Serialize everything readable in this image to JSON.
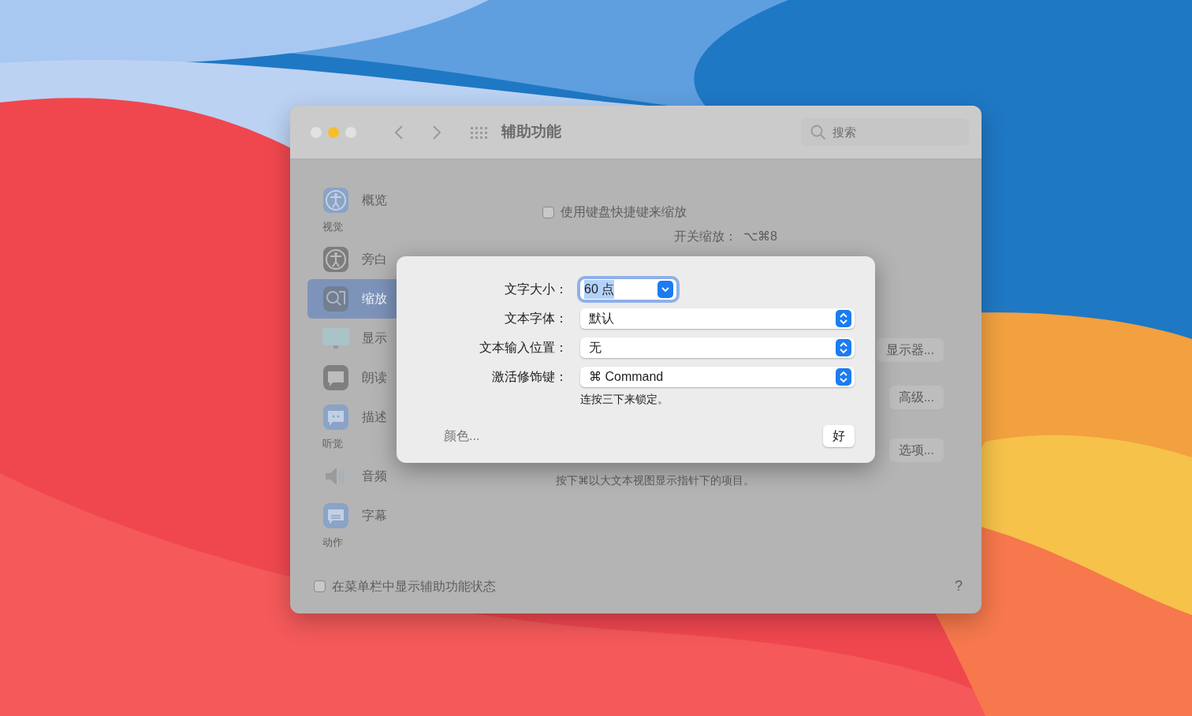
{
  "window": {
    "title": "辅助功能",
    "search": {
      "placeholder": "搜索"
    }
  },
  "sidebar": {
    "items": [
      {
        "kind": "item",
        "label": "概览",
        "selected": false
      },
      {
        "kind": "section",
        "label": "视觉"
      },
      {
        "kind": "item",
        "label": "旁白",
        "selected": false
      },
      {
        "kind": "item",
        "label": "缩放",
        "selected": true
      },
      {
        "kind": "item",
        "label": "显示",
        "selected": false
      },
      {
        "kind": "item",
        "label": "朗读",
        "selected": false
      },
      {
        "kind": "item",
        "label": "描述",
        "selected": false
      },
      {
        "kind": "section",
        "label": "听觉"
      },
      {
        "kind": "item",
        "label": "音频",
        "selected": false
      },
      {
        "kind": "item",
        "label": "字幕",
        "selected": false
      },
      {
        "kind": "section",
        "label": "动作"
      }
    ]
  },
  "main": {
    "zoom_shortcuts": {
      "label": "使用键盘快捷键来缩放",
      "checked": false
    },
    "shortcuts": [
      {
        "label": "开关缩放：",
        "keys": "⌥⌘8"
      }
    ],
    "buttons": [
      "显示器...",
      "高级...",
      "选项..."
    ],
    "hover_text_hint": "按下⌘以大文本视图显示指针下的项目。"
  },
  "footer": {
    "menu_bar_status": {
      "label": "在菜单栏中显示辅助功能状态",
      "checked": false
    },
    "help": "?"
  },
  "dialog": {
    "fields": [
      {
        "kind": "combo",
        "label": "文字大小：",
        "value": "60 点",
        "focused": true
      },
      {
        "kind": "popup",
        "label": "文本字体：",
        "value": "默认",
        "focused": false
      },
      {
        "kind": "popup",
        "label": "文本输入位置：",
        "value": "无",
        "focused": false
      },
      {
        "kind": "popup",
        "label": "激活修饰键：",
        "value": "⌘ Command",
        "focused": false
      }
    ],
    "hint": "连按三下来锁定。",
    "colors_button": "颜色...",
    "ok_button": "好"
  }
}
